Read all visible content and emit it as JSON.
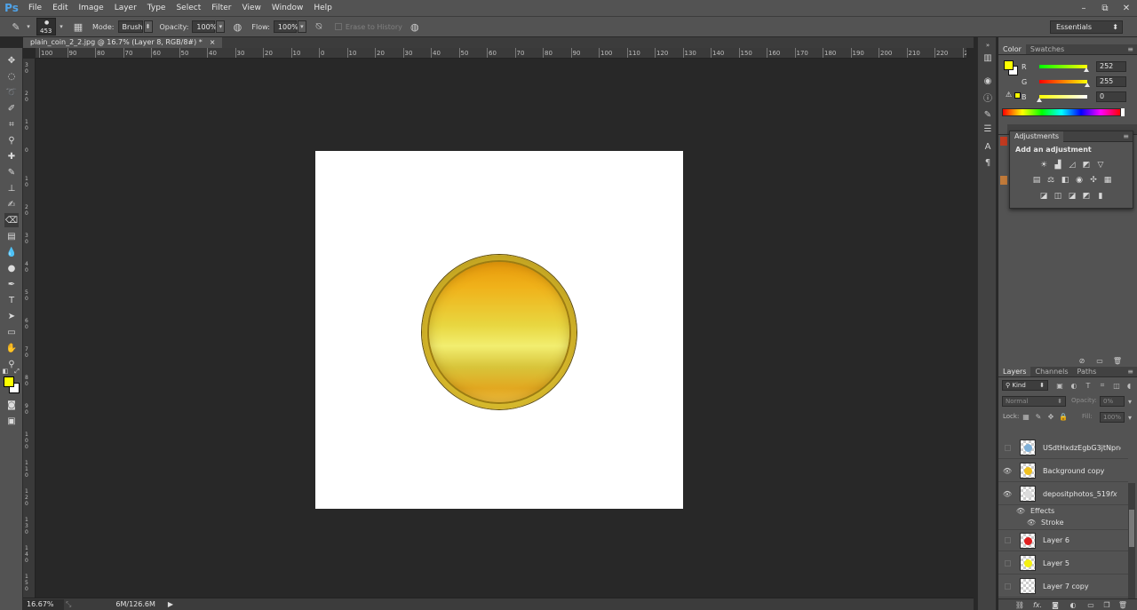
{
  "app": {
    "logo": "Ps",
    "menu": [
      "File",
      "Edit",
      "Image",
      "Layer",
      "Type",
      "Select",
      "Filter",
      "View",
      "Window",
      "Help"
    ],
    "window_controls": [
      "–",
      "⧉",
      "✕"
    ]
  },
  "options_bar": {
    "brush_size": "453",
    "mode_label": "Mode:",
    "mode_value": "Brush",
    "opacity_label": "Opacity:",
    "opacity_value": "100%",
    "flow_label": "Flow:",
    "flow_value": "100%",
    "erase_to_history": "Erase to History",
    "workspace": "Essentials"
  },
  "document": {
    "tab_title": "plain_coin_2_2.jpg @ 16.7% (Layer 8, RGB/8#) *",
    "tab_close": "×",
    "ruler_top": [
      "100",
      "90",
      "80",
      "70",
      "60",
      "50",
      "40",
      "30",
      "20",
      "10",
      "0",
      "10",
      "20",
      "30",
      "40",
      "50",
      "60",
      "70",
      "80",
      "90",
      "100",
      "110",
      "120",
      "130",
      "140",
      "150",
      "160",
      "170",
      "180",
      "190",
      "200",
      "210",
      "220",
      "230"
    ],
    "ruler_left": [
      "3 0",
      "2 0",
      "1 0",
      "0",
      "1 0",
      "2 0",
      "3 0",
      "4 0",
      "5 0",
      "6 0",
      "7 0",
      "8 0",
      "9 0",
      "1 0 0",
      "1 1 0",
      "1 2 0",
      "1 3 0",
      "1 4 0",
      "1 5 0"
    ]
  },
  "status_bar": {
    "zoom": "16.67%",
    "doc_size": "6M/126.6M",
    "arrow": "▶"
  },
  "color_panel": {
    "tabs": [
      "Color",
      "Swatches"
    ],
    "channels": [
      {
        "letter": "R",
        "value": "252",
        "fraction": 0.988
      },
      {
        "letter": "G",
        "value": "255",
        "fraction": 1.0
      },
      {
        "letter": "B",
        "value": "0",
        "fraction": 0.0
      }
    ],
    "foreground": "#fcff00"
  },
  "adjustments_panel": {
    "tab": "Adjustments",
    "title": "Add an adjustment"
  },
  "layers_panel": {
    "tabs": [
      "Layers",
      "Channels",
      "Paths"
    ],
    "filter_kind": "Kind",
    "blend_mode": "Normal",
    "opacity_label": "Opacity:",
    "opacity_value": "0%",
    "lock_label": "Lock:",
    "fill_label": "Fill:",
    "fill_value": "100%",
    "layers": [
      {
        "name": "USdtHxdzEgbG3jtNpnc...",
        "visible": false,
        "thumb": "#7fb0d8"
      },
      {
        "name": "Background copy",
        "visible": true,
        "thumb": "#f0c020"
      },
      {
        "name": "depositphotos_5191...",
        "visible": true,
        "thumb": "#dcdcdc",
        "fx": "fx"
      },
      {
        "name": "Layer 6",
        "visible": false,
        "thumb": "#e02020"
      },
      {
        "name": "Layer 5",
        "visible": false,
        "thumb": "#f4f010"
      },
      {
        "name": "Layer 7 copy",
        "visible": false,
        "thumb": ""
      }
    ],
    "effects_label": "Effects",
    "stroke_label": "Stroke",
    "bottom_fx": "fx."
  }
}
